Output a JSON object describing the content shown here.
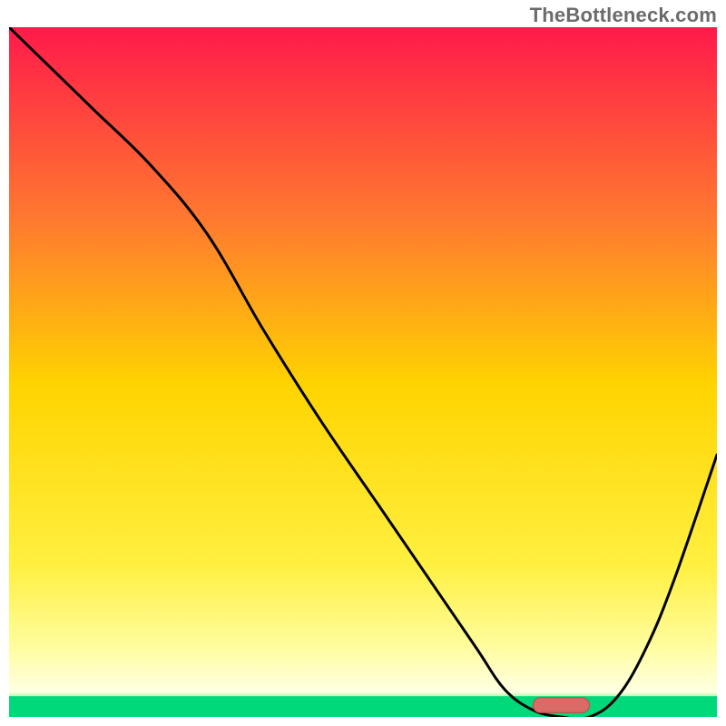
{
  "watermark": "TheBottleneck.com",
  "colors": {
    "gradient_top": "#ff1a4a",
    "gradient_mid_upper": "#ff8a2a",
    "gradient_mid": "#ffd400",
    "gradient_mid_lower": "#fff85a",
    "gradient_band": "#ffffb0",
    "gradient_bottom": "#00d97a",
    "curve": "#000000",
    "marker_fill": "#d96a66",
    "marker_stroke": "#b54f4b"
  },
  "chart_data": {
    "type": "line",
    "title": "",
    "xlabel": "",
    "ylabel": "",
    "xlim": [
      0,
      100
    ],
    "ylim": [
      0,
      100
    ],
    "x": [
      0,
      6,
      12,
      20,
      28,
      36,
      44,
      52,
      60,
      66,
      70,
      74,
      78,
      82,
      86,
      90,
      94,
      100
    ],
    "y": [
      100,
      94,
      88,
      80,
      70,
      56,
      43,
      31,
      19,
      10,
      4,
      1,
      0,
      0,
      3,
      10,
      20,
      38
    ],
    "marker": {
      "x_start": 74,
      "x_end": 82,
      "y": 0.6,
      "height": 2.2
    },
    "green_band_y": 3
  }
}
